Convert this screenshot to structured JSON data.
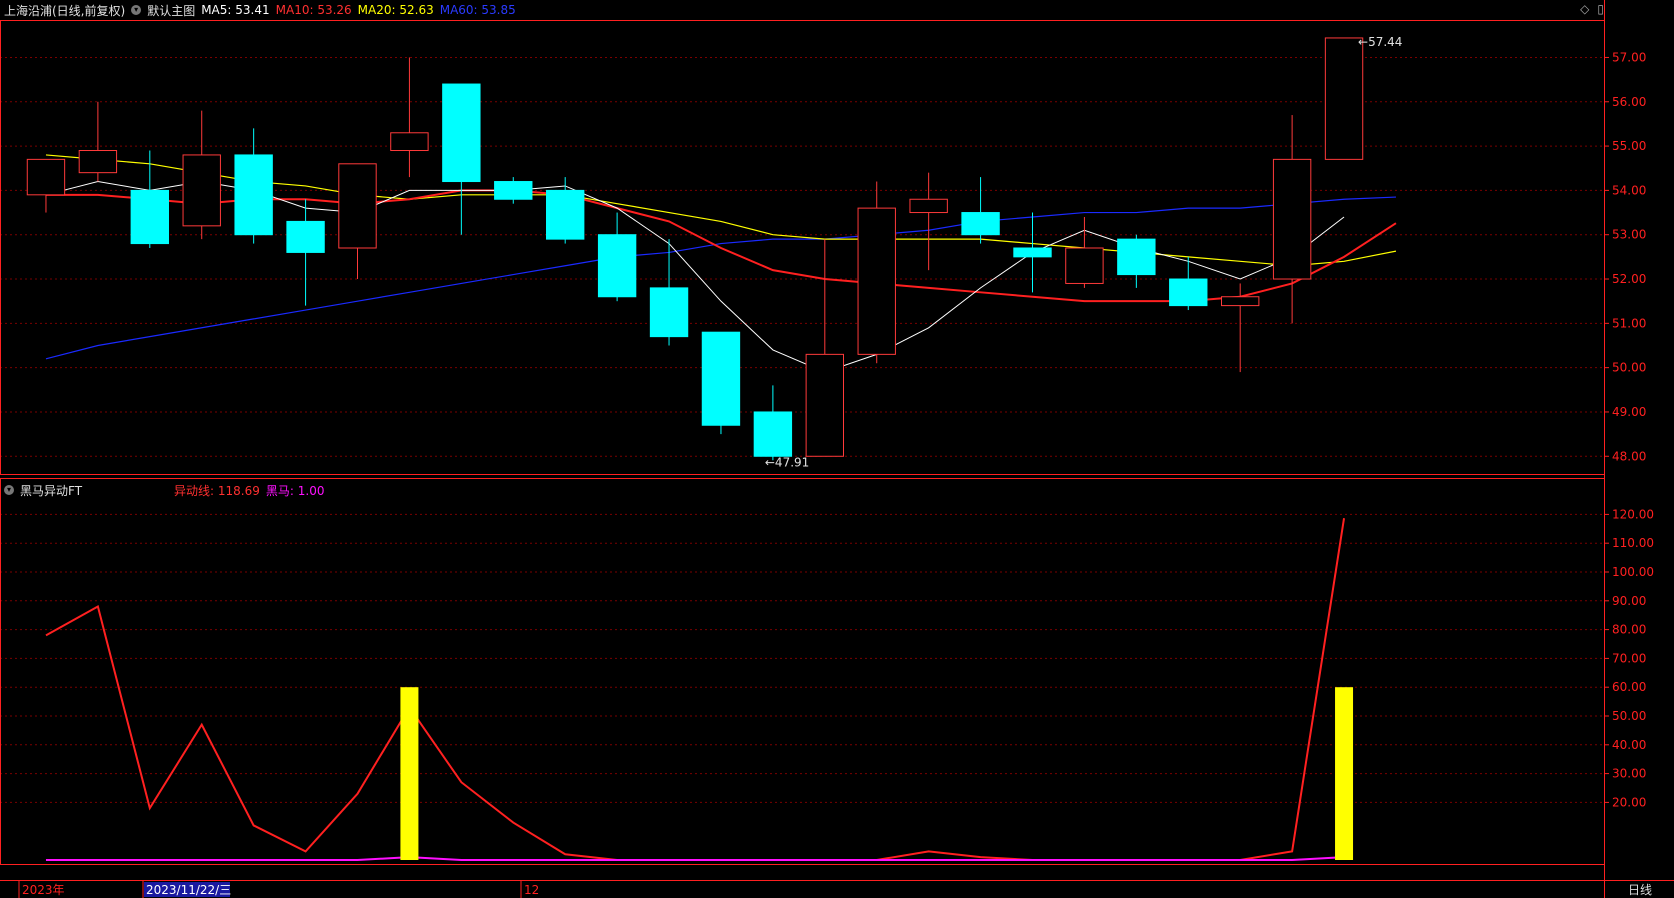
{
  "header": {
    "stock": "上海沿浦(日线,前复权)",
    "main_chart": "默认主图",
    "ma5": "MA5: 53.41",
    "ma10": "MA10: 53.26",
    "ma20": "MA20: 52.63",
    "ma60": "MA60: 53.85"
  },
  "sub_header": {
    "indicator": "黑马异动FT",
    "line": "异动线: 118.69",
    "bar": "黑马: 1.00"
  },
  "x_axis": {
    "year_label": "2023年",
    "selected_date": "2023/11/22/三",
    "month_label": "12"
  },
  "period_label": "日线",
  "colors": {
    "up": "#ff3a3a",
    "down": "#00ffff",
    "ma5": "#ffffff",
    "ma10": "#ff2020",
    "ma20": "#ffff00",
    "ma60": "#1a2aff",
    "signal": "#ff10ff",
    "bar": "#ffff00",
    "grid": "#7a0000",
    "axis": "#ff2020"
  },
  "chart_data": [
    {
      "type": "candlestick",
      "title": "上海沿浦(日线,前复权)",
      "ylim": [
        47.6,
        57.8
      ],
      "y_ticks": [
        "57.00",
        "56.00",
        "55.00",
        "54.00",
        "53.00",
        "52.00",
        "51.00",
        "50.00",
        "49.00",
        "48.00"
      ],
      "candles": [
        {
          "o": 53.9,
          "c": 54.7,
          "h": 54.7,
          "l": 53.5
        },
        {
          "o": 54.4,
          "c": 54.9,
          "h": 56.0,
          "l": 54.2
        },
        {
          "o": 54.0,
          "c": 52.8,
          "h": 54.9,
          "l": 52.7
        },
        {
          "o": 53.2,
          "c": 54.8,
          "h": 55.8,
          "l": 52.9
        },
        {
          "o": 54.8,
          "c": 53.0,
          "h": 55.4,
          "l": 52.8
        },
        {
          "o": 53.3,
          "c": 52.6,
          "h": 53.8,
          "l": 51.4
        },
        {
          "o": 52.7,
          "c": 54.6,
          "h": 54.6,
          "l": 52.0
        },
        {
          "o": 54.9,
          "c": 55.3,
          "h": 57.0,
          "l": 54.3
        },
        {
          "o": 56.4,
          "c": 54.2,
          "h": 56.4,
          "l": 53.0
        },
        {
          "o": 54.2,
          "c": 53.8,
          "h": 54.3,
          "l": 53.7
        },
        {
          "o": 54.0,
          "c": 52.9,
          "h": 54.3,
          "l": 52.8
        },
        {
          "o": 53.0,
          "c": 51.6,
          "h": 53.5,
          "l": 51.5
        },
        {
          "o": 51.8,
          "c": 50.7,
          "h": 52.9,
          "l": 50.5
        },
        {
          "o": 50.8,
          "c": 48.7,
          "h": 50.8,
          "l": 48.5
        },
        {
          "o": 49.0,
          "c": 48.0,
          "h": 49.6,
          "l": 47.91
        },
        {
          "o": 48.0,
          "c": 50.3,
          "h": 52.9,
          "l": 48.0
        },
        {
          "o": 50.3,
          "c": 53.6,
          "h": 54.2,
          "l": 50.1
        },
        {
          "o": 53.5,
          "c": 53.8,
          "h": 54.4,
          "l": 52.2
        },
        {
          "o": 53.5,
          "c": 53.0,
          "h": 54.3,
          "l": 52.8
        },
        {
          "o": 52.7,
          "c": 52.5,
          "h": 53.5,
          "l": 51.7
        },
        {
          "o": 51.9,
          "c": 52.7,
          "h": 53.4,
          "l": 51.8
        },
        {
          "o": 52.9,
          "c": 52.1,
          "h": 53.0,
          "l": 51.8
        },
        {
          "o": 52.0,
          "c": 51.4,
          "h": 52.5,
          "l": 51.3
        },
        {
          "o": 51.4,
          "c": 51.6,
          "h": 51.9,
          "l": 49.9
        },
        {
          "o": 52.0,
          "c": 54.7,
          "h": 55.7,
          "l": 51.0
        },
        {
          "o": 54.7,
          "c": 57.44,
          "h": 57.44,
          "l": 54.7
        }
      ],
      "ma5": [
        53.9,
        54.2,
        54.0,
        54.2,
        54.0,
        53.6,
        53.5,
        54.0,
        54.0,
        54.0,
        54.1,
        53.6,
        52.8,
        51.5,
        50.4,
        49.9,
        50.3,
        50.9,
        51.8,
        52.6,
        53.1,
        52.7,
        52.4,
        52.0,
        52.5,
        53.4
      ],
      "ma10": [
        53.9,
        53.9,
        53.8,
        53.7,
        53.8,
        53.8,
        53.7,
        53.8,
        54.0,
        54.0,
        53.9,
        53.6,
        53.3,
        52.7,
        52.2,
        52.0,
        51.9,
        51.8,
        51.7,
        51.6,
        51.5,
        51.5,
        51.5,
        51.6,
        51.9,
        52.5,
        53.26
      ],
      "ma20": [
        54.8,
        54.7,
        54.6,
        54.4,
        54.2,
        54.1,
        53.9,
        53.8,
        53.9,
        53.9,
        53.9,
        53.7,
        53.5,
        53.3,
        53.0,
        52.9,
        52.9,
        52.9,
        52.9,
        52.8,
        52.7,
        52.6,
        52.5,
        52.4,
        52.3,
        52.4,
        52.63
      ],
      "ma60": [
        50.2,
        50.5,
        50.7,
        50.9,
        51.1,
        51.3,
        51.5,
        51.7,
        51.9,
        52.1,
        52.3,
        52.5,
        52.6,
        52.8,
        52.9,
        52.9,
        53.0,
        53.1,
        53.3,
        53.4,
        53.5,
        53.5,
        53.6,
        53.6,
        53.7,
        53.8,
        53.85
      ],
      "annotations": [
        {
          "label": "57.44",
          "index": 25,
          "value": 57.44
        },
        {
          "label": "47.91",
          "index": 14,
          "value": 47.91
        }
      ]
    },
    {
      "type": "line",
      "title": "黑马异动FT",
      "ylim": [
        0,
        125
      ],
      "y_ticks": [
        "120.00",
        "110.00",
        "100.00",
        "90.00",
        "80.00",
        "70.00",
        "60.00",
        "50.00",
        "40.00",
        "30.00",
        "20.00"
      ],
      "series": [
        {
          "name": "异动线",
          "values": [
            78,
            88,
            18,
            47,
            12,
            3,
            23,
            53,
            27,
            13,
            2,
            0,
            0,
            0,
            0,
            0,
            0,
            3,
            1,
            0,
            0,
            0,
            0,
            0,
            3,
            118.69
          ]
        },
        {
          "name": "黑马",
          "values": [
            0,
            0,
            0,
            0,
            0,
            0,
            0,
            1,
            0,
            0,
            0,
            0,
            0,
            0,
            0,
            0,
            0,
            0,
            0,
            0,
            0,
            0,
            0,
            0,
            0,
            1
          ]
        }
      ],
      "bars": [
        {
          "index": 7,
          "value": 60
        },
        {
          "index": 25,
          "value": 60
        }
      ]
    }
  ]
}
